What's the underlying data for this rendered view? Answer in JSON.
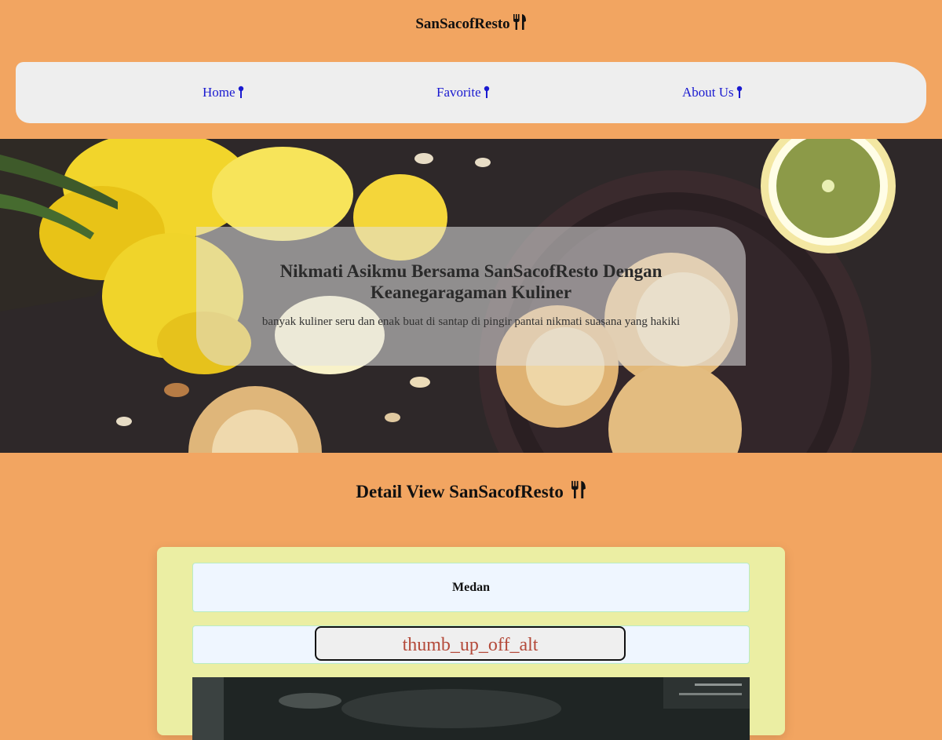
{
  "header": {
    "brand": "SanSacofResto",
    "brand_icon": "fork-knife-icon"
  },
  "nav": {
    "items": [
      {
        "label": "Home",
        "icon": "pin-icon"
      },
      {
        "label": "Favorite",
        "icon": "pin-icon"
      },
      {
        "label": "About Us",
        "icon": "pin-icon"
      }
    ]
  },
  "hero": {
    "title": "Nikmati Asikmu Bersama SanSacofResto Dengan Keanegaragaman Kuliner",
    "text": "banyak kuliner seru dan enak buat di santap di pingir pantai nikmati suasana yang hakiki"
  },
  "detail": {
    "heading": "Detail View SanSacofResto",
    "city": "Medan",
    "favorite_button_label": "thumb_up_off_alt"
  },
  "colors": {
    "page_background": "#f2a561",
    "navbar": "#eeeeee",
    "nav_link": "#1a1ad0",
    "card": "#ebeea3",
    "button_text": "#b44a3a"
  }
}
